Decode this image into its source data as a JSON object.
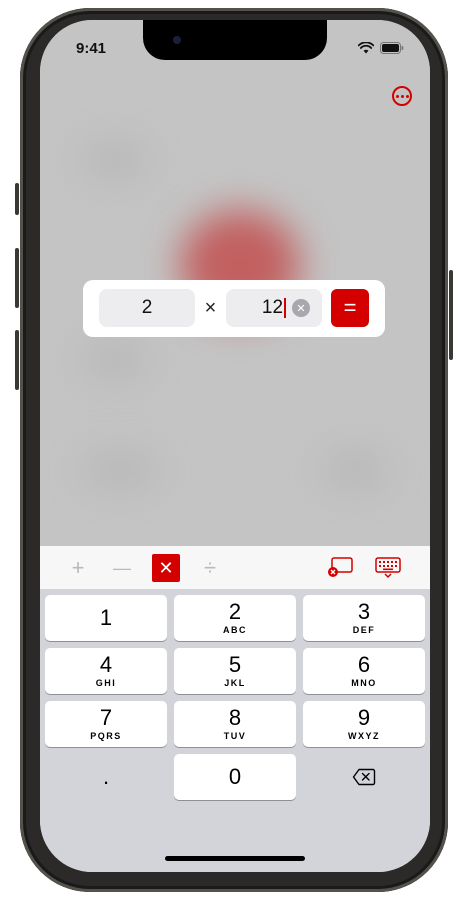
{
  "status_bar": {
    "time": "9:41"
  },
  "equation": {
    "operand_a": "2",
    "operator": "×",
    "operand_b": "12",
    "clear_symbol": "✕",
    "equals_label": "="
  },
  "toolbar": {
    "ops": [
      {
        "symbol": "+",
        "active": false
      },
      {
        "symbol": "—",
        "active": false
      },
      {
        "symbol": "✕",
        "active": true
      },
      {
        "symbol": "÷",
        "active": false
      }
    ]
  },
  "keyboard": {
    "keys": [
      {
        "num": "1",
        "letters": ""
      },
      {
        "num": "2",
        "letters": "ABC"
      },
      {
        "num": "3",
        "letters": "DEF"
      },
      {
        "num": "4",
        "letters": "GHI"
      },
      {
        "num": "5",
        "letters": "JKL"
      },
      {
        "num": "6",
        "letters": "MNO"
      },
      {
        "num": "7",
        "letters": "PQRS"
      },
      {
        "num": "8",
        "letters": "TUV"
      },
      {
        "num": "9",
        "letters": "WXYZ"
      },
      {
        "num": ".",
        "letters": ""
      },
      {
        "num": "0",
        "letters": ""
      }
    ]
  },
  "colors": {
    "accent": "#d40000",
    "keyboard_bg": "#d2d4da",
    "key_bg": "#ffffff"
  }
}
